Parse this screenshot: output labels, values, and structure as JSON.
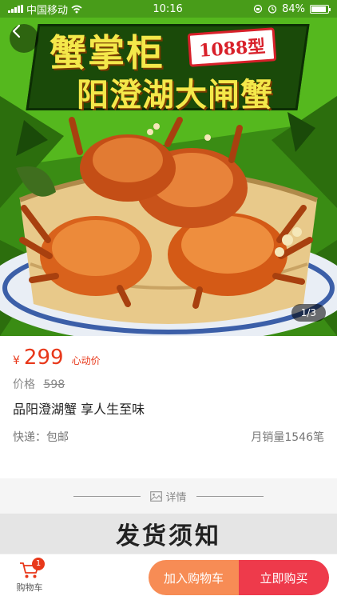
{
  "status_bar": {
    "carrier": "中国移动",
    "time": "10:16",
    "battery": "84%"
  },
  "hero": {
    "title_line1": "蟹掌柜",
    "model_badge": "1088型",
    "title_line2": "阳澄湖大闸蟹",
    "pager": "1/3"
  },
  "product": {
    "currency": "¥",
    "price": "299",
    "price_tag": "心动价",
    "original_label": "价格",
    "original_price": "598",
    "name": "品阳澄湖蟹  享人生至味",
    "shipping": "快递：包邮",
    "sales": "月销量1546笔"
  },
  "details": {
    "label": "详情",
    "notice_title": "发货须知"
  },
  "bottom": {
    "cart_label": "购物车",
    "cart_count": "1",
    "add_to_cart": "加入购物车",
    "buy_now": "立即购买"
  },
  "colors": {
    "accent_red": "#e8381a",
    "cart_button": "#f78c55",
    "buy_button": "#ee3a4b",
    "hero_green": "#3c8a16"
  }
}
